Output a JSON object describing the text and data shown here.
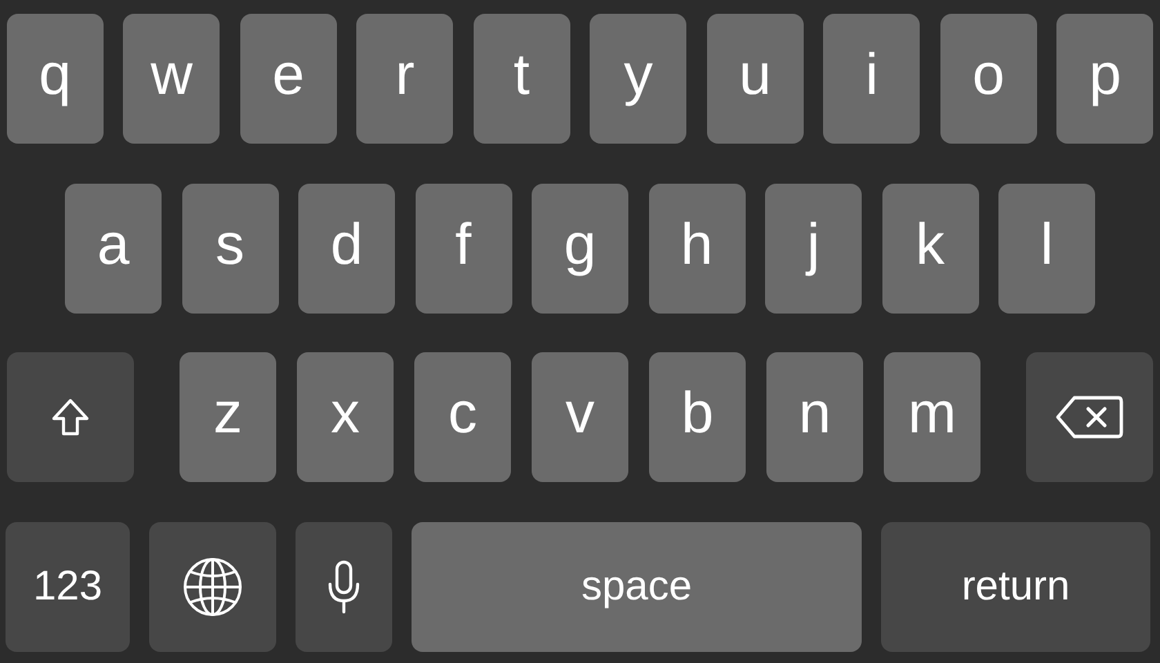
{
  "rows": [
    {
      "keys": [
        {
          "kind": "letter",
          "label": "q"
        },
        {
          "kind": "letter",
          "label": "w"
        },
        {
          "kind": "letter",
          "label": "e"
        },
        {
          "kind": "letter",
          "label": "r"
        },
        {
          "kind": "letter",
          "label": "t"
        },
        {
          "kind": "letter",
          "label": "y"
        },
        {
          "kind": "letter",
          "label": "u"
        },
        {
          "kind": "letter",
          "label": "i"
        },
        {
          "kind": "letter",
          "label": "o"
        },
        {
          "kind": "letter",
          "label": "p"
        }
      ]
    },
    {
      "keys": [
        {
          "kind": "letter",
          "label": "a"
        },
        {
          "kind": "letter",
          "label": "s"
        },
        {
          "kind": "letter",
          "label": "d"
        },
        {
          "kind": "letter",
          "label": "f"
        },
        {
          "kind": "letter",
          "label": "g"
        },
        {
          "kind": "letter",
          "label": "h"
        },
        {
          "kind": "letter",
          "label": "j"
        },
        {
          "kind": "letter",
          "label": "k"
        },
        {
          "kind": "letter",
          "label": "l"
        }
      ]
    },
    {
      "keys": [
        {
          "kind": "shift"
        },
        {
          "kind": "letter",
          "label": "z"
        },
        {
          "kind": "letter",
          "label": "x"
        },
        {
          "kind": "letter",
          "label": "c"
        },
        {
          "kind": "letter",
          "label": "v"
        },
        {
          "kind": "letter",
          "label": "b"
        },
        {
          "kind": "letter",
          "label": "n"
        },
        {
          "kind": "letter",
          "label": "m"
        },
        {
          "kind": "delete"
        }
      ]
    },
    {
      "keys": [
        {
          "kind": "numbers",
          "label": "123"
        },
        {
          "kind": "globe"
        },
        {
          "kind": "mic"
        },
        {
          "kind": "space",
          "label": "space"
        },
        {
          "kind": "return",
          "label": "return"
        }
      ]
    }
  ]
}
